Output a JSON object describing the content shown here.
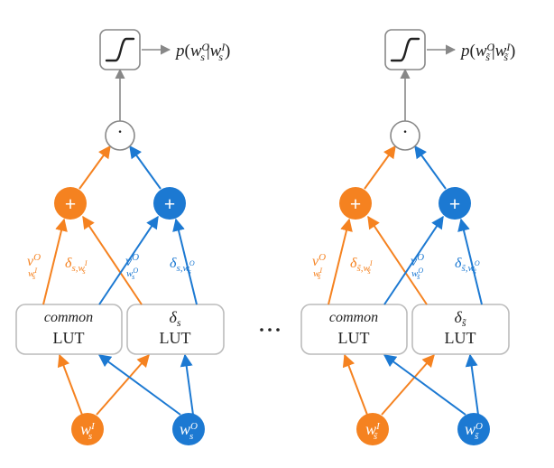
{
  "diagram": {
    "top": {
      "sigmoid_symbol": "∫",
      "p_left": "p(wₛᴼ|wₛᴵ)",
      "p_right": "p(w_ s̃ ᴼ|w_ s̃ ᴵ)"
    },
    "dot_label": "·",
    "plus_label": "+",
    "luts": {
      "common_it": "common",
      "lut": "LUT",
      "delta_s_left": "δₛ",
      "delta_s_right": "δ_ s̃ "
    },
    "inputs": {
      "wI_left": "wₛᴵ",
      "wO_left": "wₛᴼ",
      "wI_right": "w_ s̃ ᴵ",
      "wO_right": "w_ s̃ ᴼ"
    },
    "edge_labels": {
      "vO_wI_left": "v  ᴼ_{wₛᴵ}",
      "delta_s_wI_left": "δ_{s,wₛᴵ}",
      "vO_wO_left": "v  ᴼ_{wₛᴼ}",
      "delta_s_wO_left": "δ_{s,wₛᴼ}",
      "vO_wI_right": "v  ᴼ_{w_ s̃ ᴵ}",
      "delta_s_wI_right": "δ_{ s̃ ,w_ s̃ ᴵ}",
      "vO_wO_right": "v  ᴼ_{w_ s̃ ᴼ}",
      "delta_s_wO_right": "δ_{ s̃ ,w_ s̃ ᴼ}"
    },
    "ellipsis": "..."
  },
  "chart_data": {
    "type": "diagram",
    "description": "Two replicated computational graphs (left indexed by s, right indexed by s̃). For each: two bottom inputs wₛᴵ (orange) and wₛᴼ (blue) feed into a 'common LUT' box and a 'δₛ LUT' box. Those boxes emit vᴼ and δ contributions for each input, which are summed (orange + node for wᴵ-path, blue + node for wᴼ-path). The two sums feed a dot-product node '·', then a sigmoid box, producing p(wₛᴼ|wₛᴵ). The right copy is identical with s replaced by s̃.",
    "modules": [
      "common-LUT",
      "delta-LUT",
      "sum",
      "dot-product",
      "sigmoid"
    ],
    "replicas": [
      "s",
      "s̃"
    ],
    "colors": {
      "wI_path": "#f58220",
      "wO_path": "#1c79d2",
      "neutral": "#888888"
    },
    "output_left": "p(wₛᴼ | wₛᴵ)",
    "output_right": "p(w_{s̃}ᴼ | w_{s̃}ᴵ)"
  }
}
